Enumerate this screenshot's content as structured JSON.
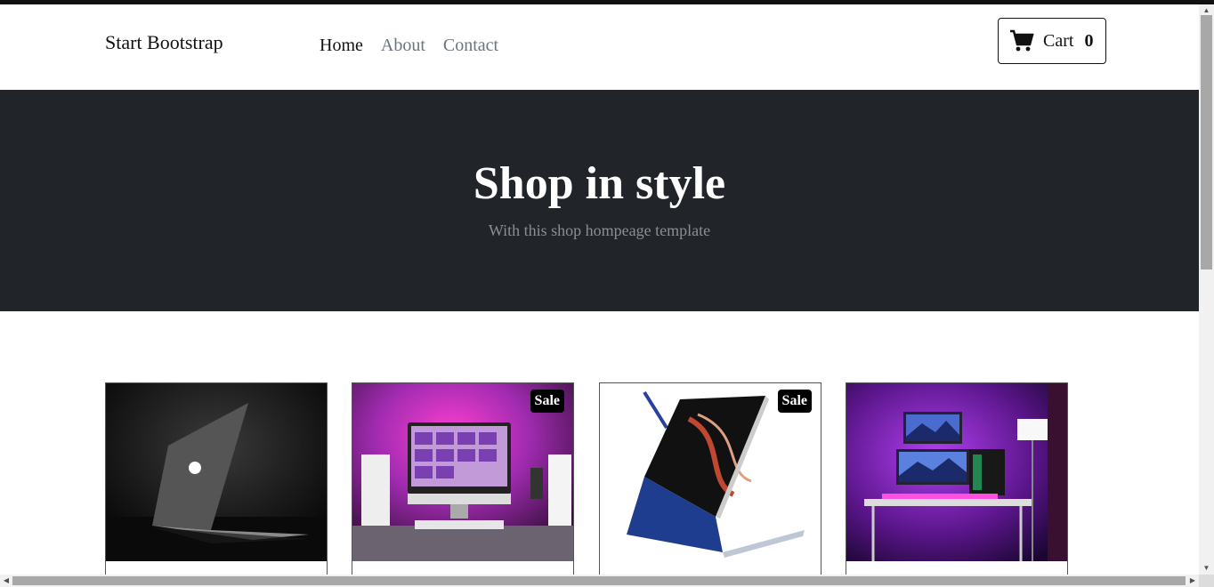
{
  "navbar": {
    "brand": "Start Bootstrap",
    "links": [
      "Home",
      "About",
      "Contact"
    ],
    "active": "Home",
    "cart": {
      "label": "Cart",
      "count": "0",
      "icon": "cart-icon"
    }
  },
  "hero": {
    "title": "Shop in style",
    "subtitle": "With this shop hompeage template"
  },
  "products": [
    {
      "image": "laptop-dark",
      "badge": ""
    },
    {
      "image": "imac-desk-pink",
      "badge": "Sale"
    },
    {
      "image": "tablet-laptop-blue",
      "badge": "Sale"
    },
    {
      "image": "gaming-setup-purple",
      "badge": ""
    }
  ],
  "colors": {
    "hero_bg": "#212529",
    "badge_bg": "#000000",
    "nav_muted": "#6c757d"
  }
}
